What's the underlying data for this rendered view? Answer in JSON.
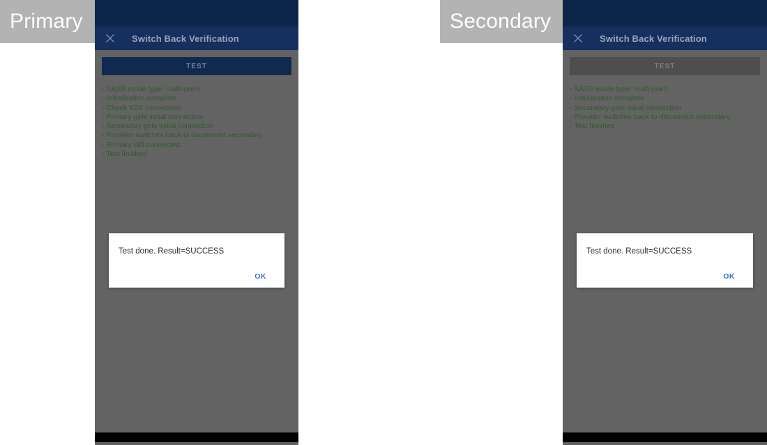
{
  "captions": {
    "primary": "Primary",
    "secondary": "Secondary"
  },
  "colors": {
    "status_bar": "#0d2548",
    "app_bar": "#152f5e",
    "content_bg": "#636363",
    "button_enabled": "#12294f",
    "button_disabled": "#4e4e4e",
    "log_text": "#2f5a2a",
    "dialog_action": "#3b6fd0",
    "caption_chip": "#b3b3b3",
    "nav_bar": "#000000"
  },
  "primary": {
    "app_bar": {
      "close_icon": "close-icon",
      "title": "Switch Back Verification"
    },
    "test_button": {
      "label": "TEST",
      "enabled": true
    },
    "log_lines": [
      "- SASS mode type: multi-point",
      "- Initialization complete",
      "- Check V2V connection.",
      "- Primary gets initial connection",
      "- Secondary gets initial connection",
      "- Provider switches back to disconnect secondary",
      "- Primary still connected.",
      "- Test finished"
    ],
    "dialog": {
      "message": "Test done. Result=SUCCESS",
      "ok_label": "OK"
    }
  },
  "secondary": {
    "app_bar": {
      "close_icon": "close-icon",
      "title": "Switch Back Verification"
    },
    "test_button": {
      "label": "TEST",
      "enabled": false
    },
    "log_lines": [
      "- SASS mode type: multi-point",
      "- Initialization complete",
      "- Secondary gets initial connection",
      "- Provider switches back to disconnect secondary",
      "- Test finished"
    ],
    "dialog": {
      "message": "Test done. Result=SUCCESS",
      "ok_label": "OK"
    }
  }
}
